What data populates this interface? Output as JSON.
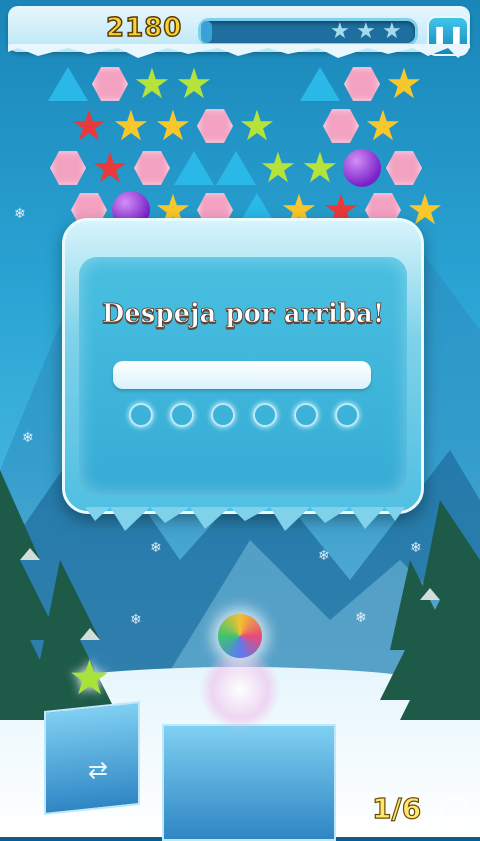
{
  "hud": {
    "score": "2180",
    "progress_fraction": 0.05,
    "stars_total": 3,
    "stars_earned": 0,
    "pause_icon": "pause-icon"
  },
  "dialog": {
    "title": "Despeja por arriba!",
    "dots_count": 6
  },
  "shooter": {
    "current_bubble": "rainbow-ball",
    "next_bubble": "green-star",
    "swap_icon": "swap-arrows-icon"
  },
  "counter": "1/6",
  "colors": {
    "pink": "#f4a2c2",
    "blue": "#29b8e8",
    "yellow": "#f7c72c",
    "green": "#b6e23c",
    "red": "#e83a3a",
    "purple": "#8a2bd6",
    "score_yellow": "#f6d43a"
  },
  "board": [
    [
      "blue-tri",
      "pink-hex",
      "green-star",
      "green-star",
      "",
      "",
      "blue-tri",
      "pink-hex",
      "yellow-star"
    ],
    [
      "red-star",
      "yellow-star",
      "yellow-star",
      "pink-hex",
      "green-star",
      "",
      "pink-hex",
      "yellow-star",
      ""
    ],
    [
      "pink-hex",
      "red-star",
      "pink-hex",
      "blue-tri",
      "blue-tri",
      "green-star",
      "green-star",
      "purple-ball",
      "pink-hex"
    ],
    [
      "pink-hex",
      "purple-ball",
      "yellow-star",
      "pink-hex",
      "blue-tri",
      "yellow-star",
      "red-star",
      "pink-hex",
      "yellow-star"
    ]
  ]
}
